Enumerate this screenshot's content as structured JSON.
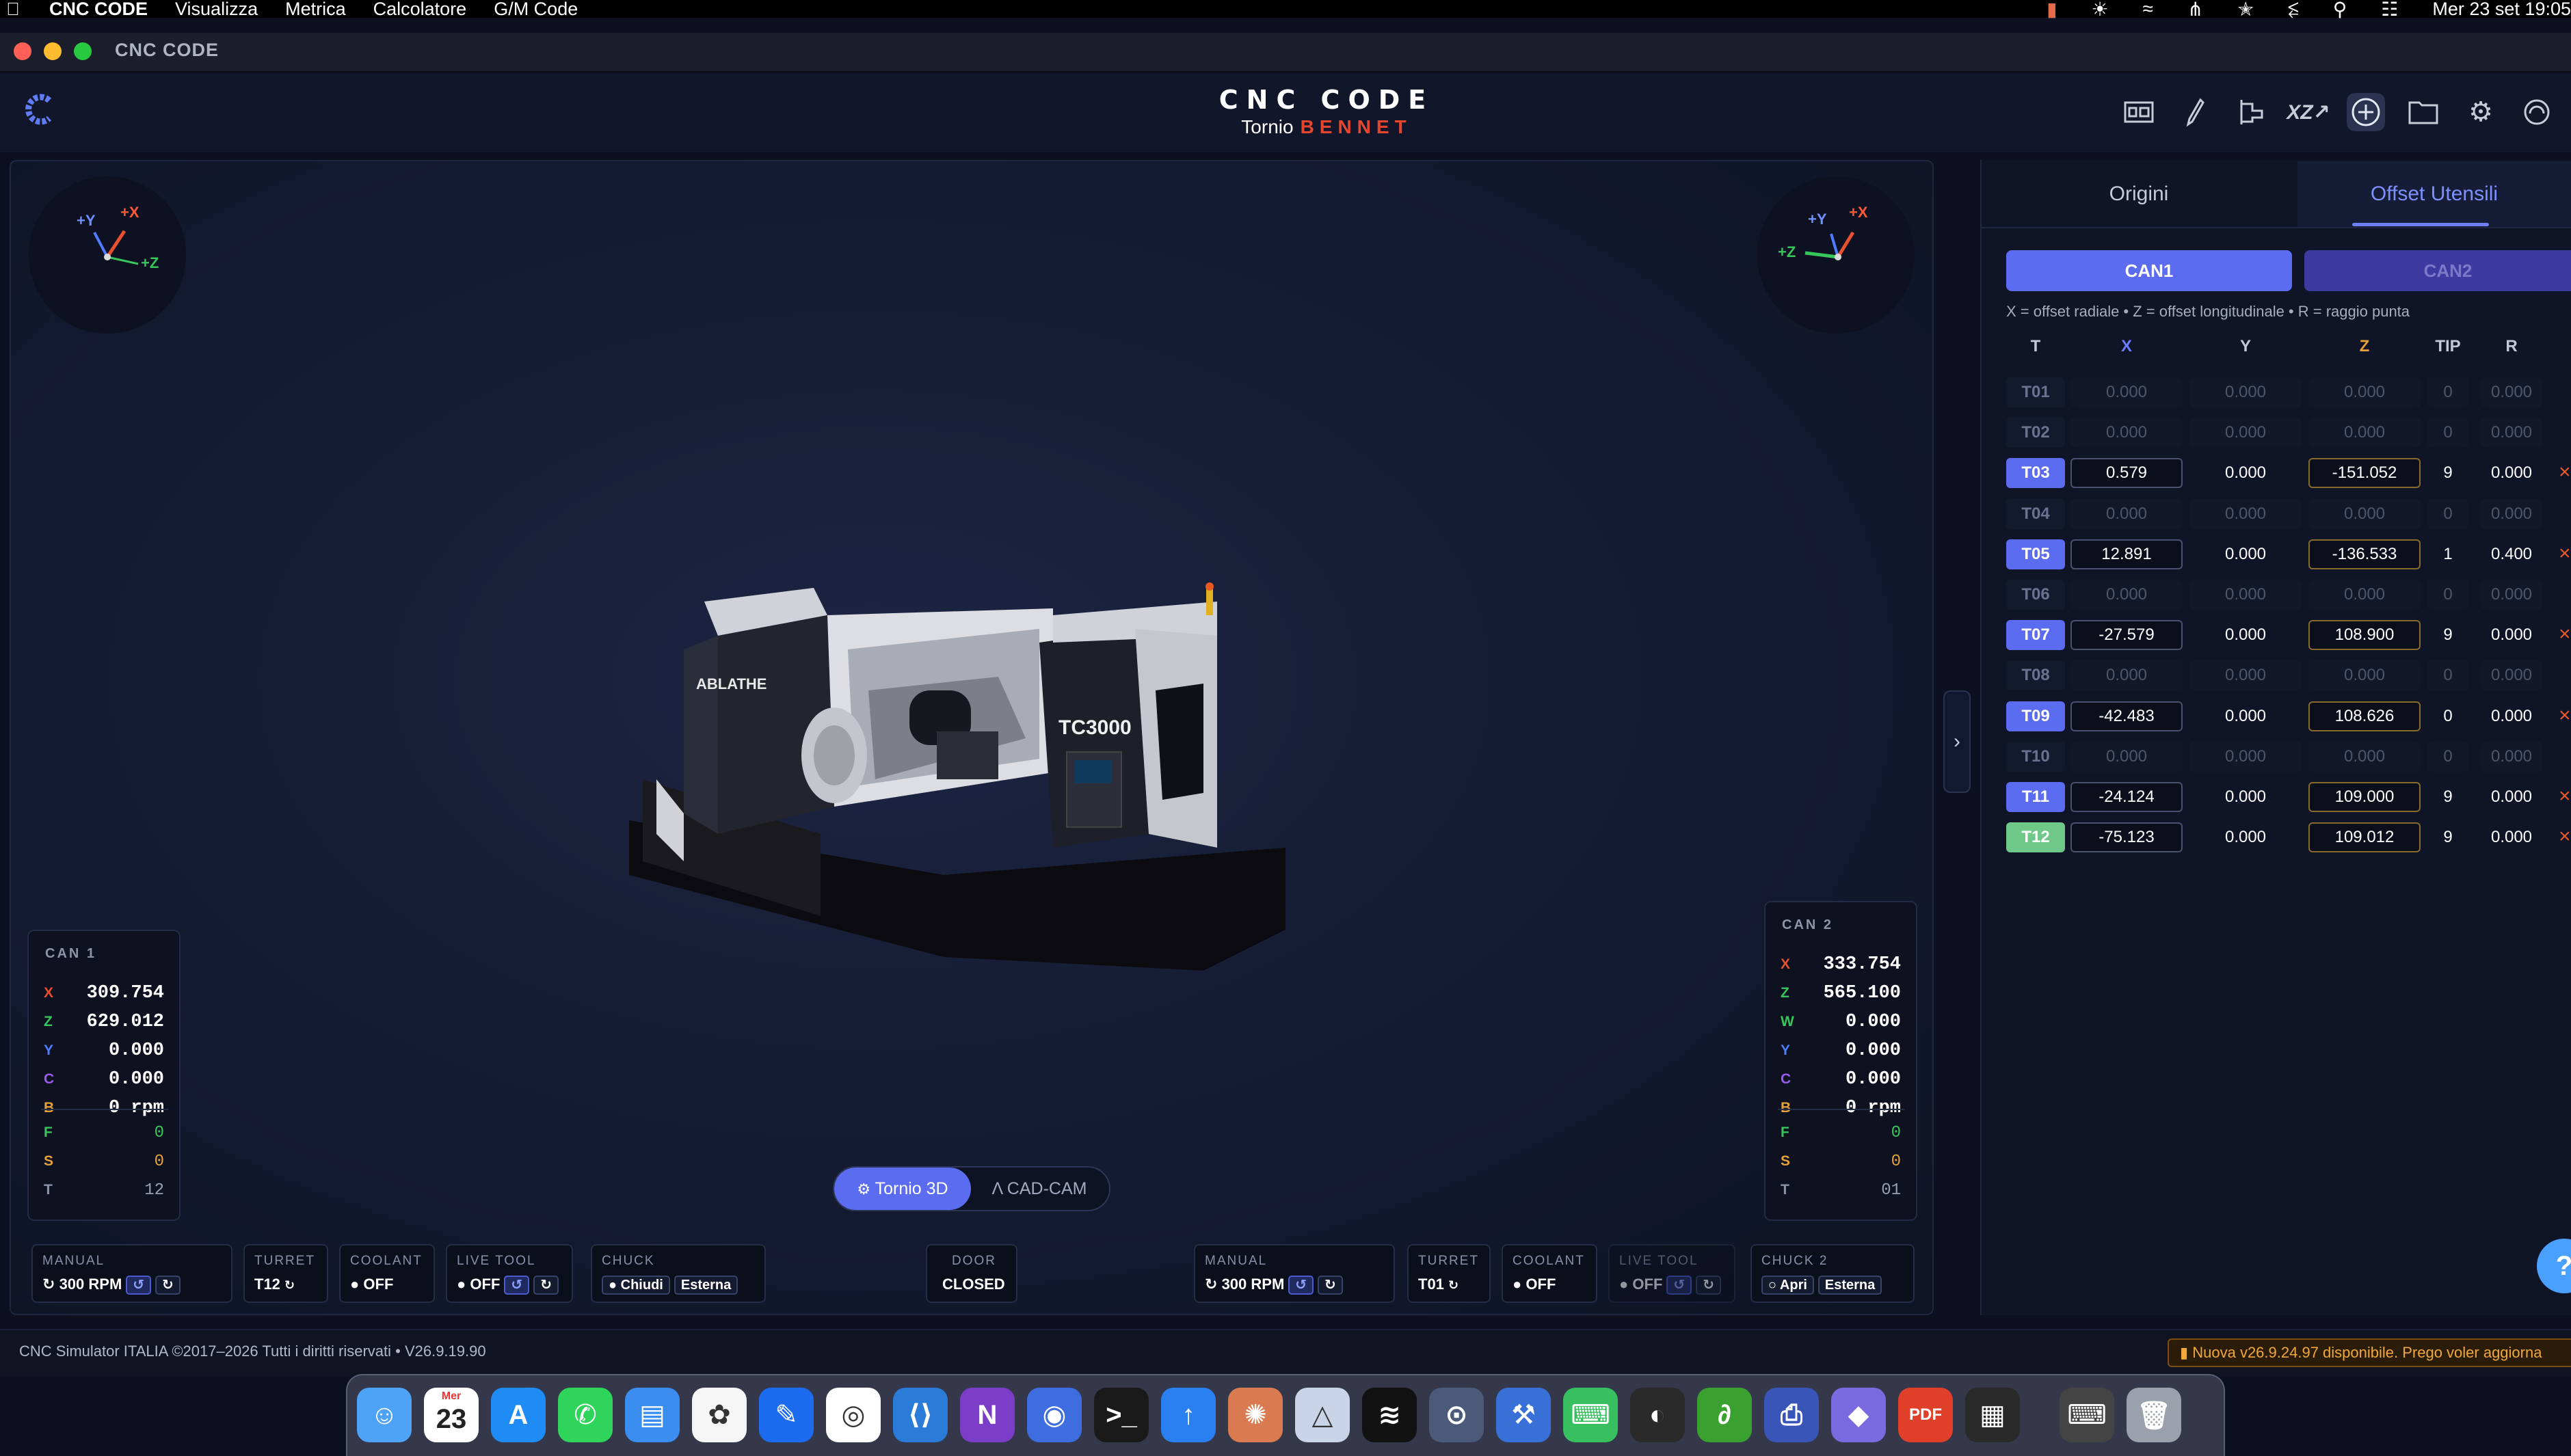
{
  "menubar": {
    "app_name": "CNC CODE",
    "items": [
      "Visualizza",
      "Metrica",
      "Calcolatore",
      "G/M Code"
    ],
    "clock": "Mer 23 set  19:05"
  },
  "window": {
    "title": "CNC CODE"
  },
  "header": {
    "title": "CNC CODE",
    "subtitle_prefix": "Tornio",
    "subtitle_brand": "BENNET",
    "toolbar_icons": [
      "machine-icon",
      "tool-icon",
      "workholding-icon",
      "xz-axis-icon",
      "add-icon",
      "folder-icon",
      "settings-icon",
      "help-icon"
    ]
  },
  "gizmo_left": {
    "y": "+Y",
    "x": "+X",
    "z": "+Z"
  },
  "gizmo_right": {
    "y": "+Y",
    "x": "+X",
    "z": "+Z"
  },
  "machine": {
    "brand_label": "ABLATHE",
    "model_label": "TC3000"
  },
  "can1": {
    "title": "CAN 1",
    "rows": [
      {
        "axis": "X",
        "value": "309.754"
      },
      {
        "axis": "Z",
        "value": "629.012"
      },
      {
        "axis": "Y",
        "value": "0.000"
      },
      {
        "axis": "C",
        "value": "0.000"
      },
      {
        "axis": "B",
        "value": "0 rpm"
      }
    ],
    "fst": [
      {
        "axis": "F",
        "value": "0"
      },
      {
        "axis": "S",
        "value": "0"
      },
      {
        "axis": "T",
        "value": "12"
      }
    ]
  },
  "can2": {
    "title": "CAN 2",
    "rows": [
      {
        "axis": "X",
        "value": "333.754"
      },
      {
        "axis": "Z",
        "value": "565.100"
      },
      {
        "axis": "W",
        "value": "0.000"
      },
      {
        "axis": "Y",
        "value": "0.000"
      },
      {
        "axis": "C",
        "value": "0.000"
      },
      {
        "axis": "B",
        "value": "0 rpm"
      }
    ],
    "fst": [
      {
        "axis": "F",
        "value": "0"
      },
      {
        "axis": "S",
        "value": "0"
      },
      {
        "axis": "T",
        "value": "01"
      }
    ]
  },
  "mode_toggle": {
    "active": "Tornio 3D",
    "inactive": "CAD-CAM"
  },
  "controls1": {
    "manual_label": "MANUAL",
    "manual_value": "300 RPM",
    "turret_label": "TURRET",
    "turret_value": "T12",
    "coolant_label": "COOLANT",
    "coolant_value": "OFF",
    "livetool_label": "LIVE TOOL",
    "livetool_value": "OFF",
    "chuck_label": "CHUCK",
    "chuck_btn1": "Chiudi",
    "chuck_btn2": "Esterna"
  },
  "door": {
    "label": "DOOR",
    "value": "CLOSED"
  },
  "controls2": {
    "manual_label": "MANUAL",
    "manual_value": "300 RPM",
    "turret_label": "TURRET",
    "turret_value": "T01",
    "coolant_label": "COOLANT",
    "coolant_value": "OFF",
    "livetool_label": "LIVE TOOL",
    "livetool_value": "OFF",
    "chuck_label": "CHUCK 2",
    "chuck_btn1": "Apri",
    "chuck_btn2": "Esterna"
  },
  "panel": {
    "tabs": [
      "Origini",
      "Offset Utensili"
    ],
    "active_tab": "Offset Utensili",
    "can_buttons": [
      "CAN1",
      "CAN2"
    ],
    "legend": "X = offset radiale  •  Z = offset longitudinale  •  R = raggio punta",
    "columns": [
      "T",
      "X",
      "Y",
      "Z",
      "TIP",
      "R"
    ],
    "rows": [
      {
        "t": "T01",
        "x": "0.000",
        "y": "0.000",
        "z": "0.000",
        "tip": "0",
        "r": "0.000",
        "active": false
      },
      {
        "t": "T02",
        "x": "0.000",
        "y": "0.000",
        "z": "0.000",
        "tip": "0",
        "r": "0.000",
        "active": false
      },
      {
        "t": "T03",
        "x": "0.579",
        "y": "0.000",
        "z": "-151.052",
        "tip": "9",
        "r": "0.000",
        "active": true
      },
      {
        "t": "T04",
        "x": "0.000",
        "y": "0.000",
        "z": "0.000",
        "tip": "0",
        "r": "0.000",
        "active": false
      },
      {
        "t": "T05",
        "x": "12.891",
        "y": "0.000",
        "z": "-136.533",
        "tip": "1",
        "r": "0.400",
        "active": true
      },
      {
        "t": "T06",
        "x": "0.000",
        "y": "0.000",
        "z": "0.000",
        "tip": "0",
        "r": "0.000",
        "active": false
      },
      {
        "t": "T07",
        "x": "-27.579",
        "y": "0.000",
        "z": "108.900",
        "tip": "9",
        "r": "0.000",
        "active": true
      },
      {
        "t": "T08",
        "x": "0.000",
        "y": "0.000",
        "z": "0.000",
        "tip": "0",
        "r": "0.000",
        "active": false
      },
      {
        "t": "T09",
        "x": "-42.483",
        "y": "0.000",
        "z": "108.626",
        "tip": "0",
        "r": "0.000",
        "active": true
      },
      {
        "t": "T10",
        "x": "0.000",
        "y": "0.000",
        "z": "0.000",
        "tip": "0",
        "r": "0.000",
        "active": false
      },
      {
        "t": "T11",
        "x": "-24.124",
        "y": "0.000",
        "z": "109.000",
        "tip": "9",
        "r": "0.000",
        "active": true
      },
      {
        "t": "T12",
        "x": "-75.123",
        "y": "0.000",
        "z": "109.012",
        "tip": "9",
        "r": "0.000",
        "active": true,
        "current": true
      }
    ]
  },
  "footer": {
    "text": "CNC Simulator ITALIA  ©2017–2026  Tutti i diritti riservati  •  V26.9.19.90",
    "update": "Nuova v26.9.24.97 disponibile. Prego voler aggiorna"
  },
  "dock": {
    "calendar_month": "Mer",
    "calendar_day": "23",
    "apps": [
      "finder",
      "calendar",
      "app-store",
      "whatsapp",
      "files",
      "photos",
      "xcode",
      "chrome",
      "vscode",
      "onenote",
      "firefox",
      "terminal",
      "transfer",
      "claude",
      "affinity",
      "spotify",
      "installer",
      "hammer",
      "gamepad",
      "davinci",
      "affinity-designer",
      "printer",
      "notion",
      "pdf",
      "widget",
      "keyboard",
      "trash"
    ]
  },
  "colors": {
    "accent": "#5b6cf0",
    "x_axis": "#e8502f",
    "z_axis": "#37c65a",
    "y_axis": "#4f7dff",
    "current_tool": "#6fc788",
    "brand_red": "#e6462e"
  }
}
